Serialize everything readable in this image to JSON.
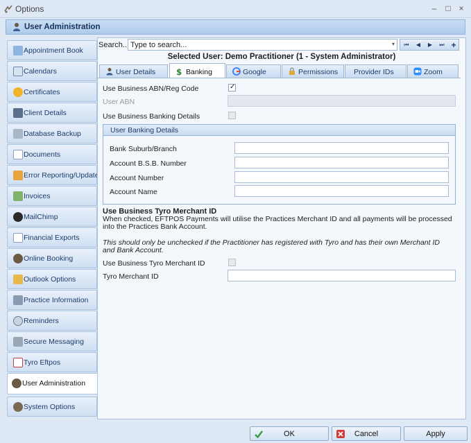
{
  "window": {
    "title": "Options",
    "minimize": "–",
    "maximize": "□",
    "close": "×"
  },
  "header": {
    "title": "User Administration"
  },
  "sidebar": {
    "items": [
      {
        "label": "Appointment Book"
      },
      {
        "label": "Calendars"
      },
      {
        "label": "Certificates"
      },
      {
        "label": "Client Details"
      },
      {
        "label": "Database Backup"
      },
      {
        "label": "Documents"
      },
      {
        "label": "Error Reporting/Updates"
      },
      {
        "label": "Invoices"
      },
      {
        "label": "MailChimp"
      },
      {
        "label": "Financial Exports"
      },
      {
        "label": "Online Booking"
      },
      {
        "label": "Outlook Options"
      },
      {
        "label": "Practice Information"
      },
      {
        "label": "Reminders"
      },
      {
        "label": "Secure Messaging"
      },
      {
        "label": "Tyro Eftpos"
      },
      {
        "label": "User Administration"
      },
      {
        "label": "System Options"
      }
    ]
  },
  "search": {
    "label": "Search...",
    "placeholder": "Type to search..."
  },
  "nav": {
    "first": "⏮",
    "prev": "◀",
    "next": "▶",
    "last": "⏭",
    "add": "+"
  },
  "selected_user": "Selected User: Demo Practitioner (1 - System Administrator)",
  "tabs": [
    {
      "label": "User Details"
    },
    {
      "label": "Banking"
    },
    {
      "label": "Google"
    },
    {
      "label": "Permissions"
    },
    {
      "label": "Provider IDs"
    },
    {
      "label": "Zoom"
    }
  ],
  "banking": {
    "use_abn_label": "Use Business ABN/Reg Code",
    "use_abn_checked": true,
    "user_abn_label": "User ABN",
    "use_banking_label": "Use Business Banking Details",
    "use_banking_checked": false,
    "group_title": "User Banking Details",
    "bank_suburb_label": "Bank Suburb/Branch",
    "bsb_label": "Account B.S.B. Number",
    "account_number_label": "Account Number",
    "account_name_label": "Account Name",
    "tyro_title": "Use Business Tyro Merchant ID",
    "tyro_desc": "When checked, EFTPOS Payments will utilise the Practices Merchant ID and all payments will be processed into the Practices Bank Account.",
    "tyro_note": "This should only be unchecked if the Practitioner has registered with Tyro and has their own Merchant ID and Bank Account.",
    "use_tyro_label": "Use Business Tyro Merchant ID",
    "use_tyro_checked": false,
    "tyro_merchant_label": "Tyro Merchant ID"
  },
  "footer": {
    "ok": "OK",
    "cancel": "Cancel",
    "apply": "Apply"
  }
}
